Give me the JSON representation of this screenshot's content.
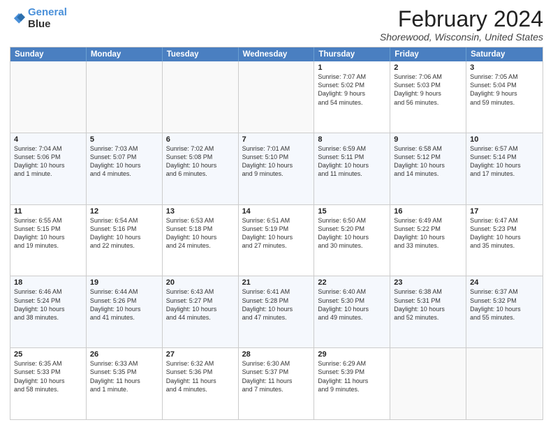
{
  "logo": {
    "line1": "General",
    "line2": "Blue"
  },
  "title": "February 2024",
  "subtitle": "Shorewood, Wisconsin, United States",
  "headers": [
    "Sunday",
    "Monday",
    "Tuesday",
    "Wednesday",
    "Thursday",
    "Friday",
    "Saturday"
  ],
  "rows": [
    [
      {
        "day": "",
        "info": ""
      },
      {
        "day": "",
        "info": ""
      },
      {
        "day": "",
        "info": ""
      },
      {
        "day": "",
        "info": ""
      },
      {
        "day": "1",
        "info": "Sunrise: 7:07 AM\nSunset: 5:02 PM\nDaylight: 9 hours\nand 54 minutes."
      },
      {
        "day": "2",
        "info": "Sunrise: 7:06 AM\nSunset: 5:03 PM\nDaylight: 9 hours\nand 56 minutes."
      },
      {
        "day": "3",
        "info": "Sunrise: 7:05 AM\nSunset: 5:04 PM\nDaylight: 9 hours\nand 59 minutes."
      }
    ],
    [
      {
        "day": "4",
        "info": "Sunrise: 7:04 AM\nSunset: 5:06 PM\nDaylight: 10 hours\nand 1 minute."
      },
      {
        "day": "5",
        "info": "Sunrise: 7:03 AM\nSunset: 5:07 PM\nDaylight: 10 hours\nand 4 minutes."
      },
      {
        "day": "6",
        "info": "Sunrise: 7:02 AM\nSunset: 5:08 PM\nDaylight: 10 hours\nand 6 minutes."
      },
      {
        "day": "7",
        "info": "Sunrise: 7:01 AM\nSunset: 5:10 PM\nDaylight: 10 hours\nand 9 minutes."
      },
      {
        "day": "8",
        "info": "Sunrise: 6:59 AM\nSunset: 5:11 PM\nDaylight: 10 hours\nand 11 minutes."
      },
      {
        "day": "9",
        "info": "Sunrise: 6:58 AM\nSunset: 5:12 PM\nDaylight: 10 hours\nand 14 minutes."
      },
      {
        "day": "10",
        "info": "Sunrise: 6:57 AM\nSunset: 5:14 PM\nDaylight: 10 hours\nand 17 minutes."
      }
    ],
    [
      {
        "day": "11",
        "info": "Sunrise: 6:55 AM\nSunset: 5:15 PM\nDaylight: 10 hours\nand 19 minutes."
      },
      {
        "day": "12",
        "info": "Sunrise: 6:54 AM\nSunset: 5:16 PM\nDaylight: 10 hours\nand 22 minutes."
      },
      {
        "day": "13",
        "info": "Sunrise: 6:53 AM\nSunset: 5:18 PM\nDaylight: 10 hours\nand 24 minutes."
      },
      {
        "day": "14",
        "info": "Sunrise: 6:51 AM\nSunset: 5:19 PM\nDaylight: 10 hours\nand 27 minutes."
      },
      {
        "day": "15",
        "info": "Sunrise: 6:50 AM\nSunset: 5:20 PM\nDaylight: 10 hours\nand 30 minutes."
      },
      {
        "day": "16",
        "info": "Sunrise: 6:49 AM\nSunset: 5:22 PM\nDaylight: 10 hours\nand 33 minutes."
      },
      {
        "day": "17",
        "info": "Sunrise: 6:47 AM\nSunset: 5:23 PM\nDaylight: 10 hours\nand 35 minutes."
      }
    ],
    [
      {
        "day": "18",
        "info": "Sunrise: 6:46 AM\nSunset: 5:24 PM\nDaylight: 10 hours\nand 38 minutes."
      },
      {
        "day": "19",
        "info": "Sunrise: 6:44 AM\nSunset: 5:26 PM\nDaylight: 10 hours\nand 41 minutes."
      },
      {
        "day": "20",
        "info": "Sunrise: 6:43 AM\nSunset: 5:27 PM\nDaylight: 10 hours\nand 44 minutes."
      },
      {
        "day": "21",
        "info": "Sunrise: 6:41 AM\nSunset: 5:28 PM\nDaylight: 10 hours\nand 47 minutes."
      },
      {
        "day": "22",
        "info": "Sunrise: 6:40 AM\nSunset: 5:30 PM\nDaylight: 10 hours\nand 49 minutes."
      },
      {
        "day": "23",
        "info": "Sunrise: 6:38 AM\nSunset: 5:31 PM\nDaylight: 10 hours\nand 52 minutes."
      },
      {
        "day": "24",
        "info": "Sunrise: 6:37 AM\nSunset: 5:32 PM\nDaylight: 10 hours\nand 55 minutes."
      }
    ],
    [
      {
        "day": "25",
        "info": "Sunrise: 6:35 AM\nSunset: 5:33 PM\nDaylight: 10 hours\nand 58 minutes."
      },
      {
        "day": "26",
        "info": "Sunrise: 6:33 AM\nSunset: 5:35 PM\nDaylight: 11 hours\nand 1 minute."
      },
      {
        "day": "27",
        "info": "Sunrise: 6:32 AM\nSunset: 5:36 PM\nDaylight: 11 hours\nand 4 minutes."
      },
      {
        "day": "28",
        "info": "Sunrise: 6:30 AM\nSunset: 5:37 PM\nDaylight: 11 hours\nand 7 minutes."
      },
      {
        "day": "29",
        "info": "Sunrise: 6:29 AM\nSunset: 5:39 PM\nDaylight: 11 hours\nand 9 minutes."
      },
      {
        "day": "",
        "info": ""
      },
      {
        "day": "",
        "info": ""
      }
    ]
  ]
}
